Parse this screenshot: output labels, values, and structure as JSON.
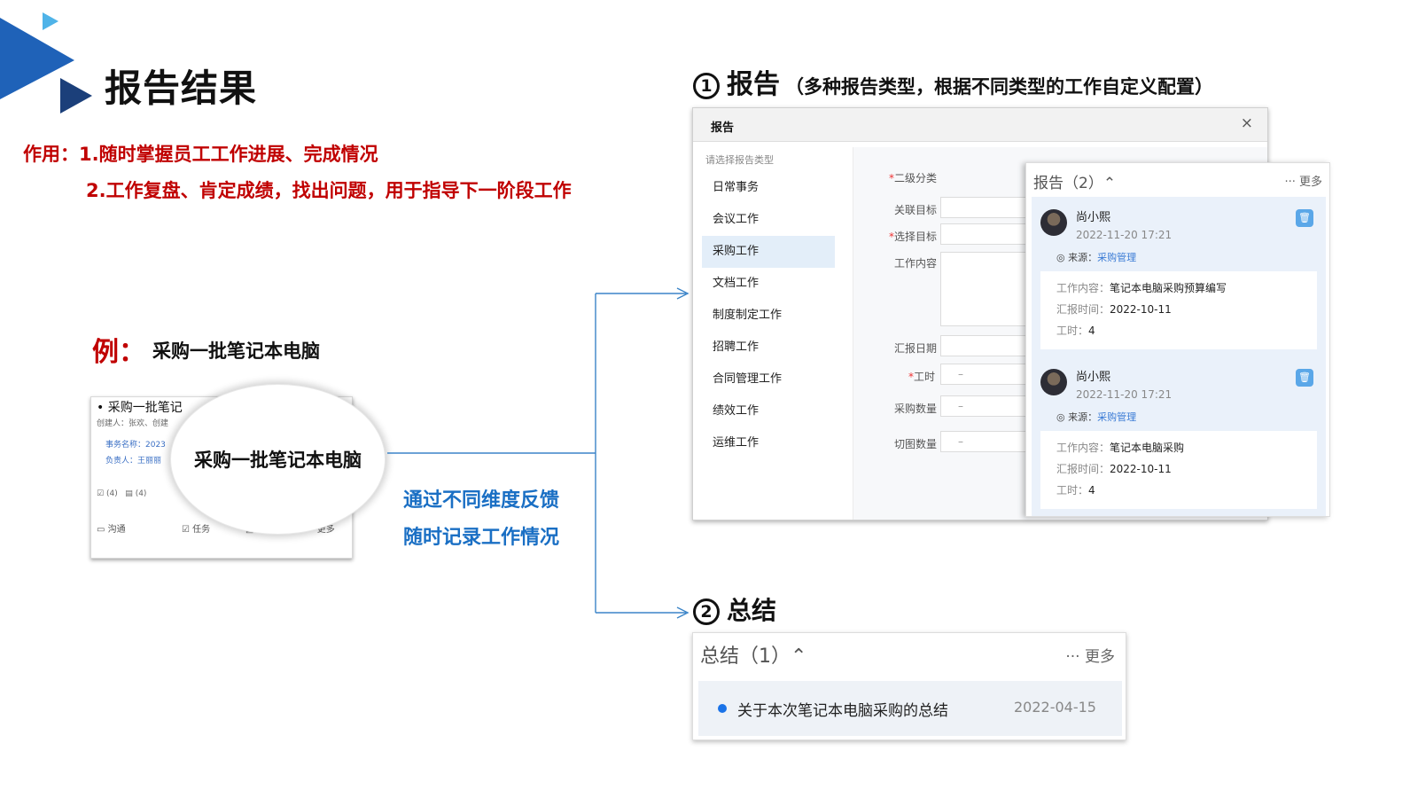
{
  "slide": {
    "title": "报告结果",
    "purpose_line1": "作用：1.随时掌握员工工作进展、完成情况",
    "purpose_line2": "2.工作复盘、肯定成绩，找出问题，用于指导下一阶段工作",
    "example_label": "例：",
    "example_text": "采购一批笔记本电脑",
    "feedback_line1": "通过不同维度反馈",
    "feedback_line2": "随时记录工作情况"
  },
  "colors": {
    "accent_blue": "#1a6fc4",
    "accent_red": "#c00000",
    "deco_blue": "#1f62b8"
  },
  "mini_card": {
    "title": "采购一批笔记",
    "creator_line": "创建人：张欢、创建",
    "field1": "事务名称：2023",
    "field2": "负责人：王丽丽",
    "count1": "(4)",
    "count2": "(4)",
    "footer": {
      "communicate": "沟通",
      "task": "任务",
      "report": "报告",
      "more": "··· 更多"
    }
  },
  "magnifier_text": "采购一批笔记本电脑",
  "section1": {
    "num": "1",
    "title": "报告",
    "subtitle": "（多种报告类型，根据不同类型的工作自定义配置）"
  },
  "section2": {
    "num": "2",
    "title": "总结"
  },
  "dialog": {
    "title": "报告",
    "close": "×",
    "hint": "请选择报告类型",
    "types": [
      "日常事务",
      "会议工作",
      "采购工作",
      "文档工作",
      "制度制定工作",
      "招聘工作",
      "合同管理工作",
      "绩效工作",
      "运维工作"
    ],
    "form": {
      "level2": "二级分类",
      "related_goal": "关联目标",
      "select_goal": "选择目标",
      "work_content": "工作内容",
      "report_date": "汇报日期",
      "hours": "工时",
      "purchase_qty": "采购数量",
      "cut_qty": "切图数量",
      "dash": "–"
    }
  },
  "report_panel": {
    "header": "报告（2）⌃",
    "more": "··· 更多",
    "cards": [
      {
        "name": "尚小熙",
        "time": "2022-11-20 17:21",
        "source_label": "来源：",
        "source_link": "采购管理",
        "content_label": "工作内容：",
        "content": "笔记本电脑采购预算编写",
        "date_label": "汇报时间：",
        "date": "2022-10-11",
        "hours_label": "工时：",
        "hours": "4"
      },
      {
        "name": "尚小熙",
        "time": "2022-11-20 17:21",
        "source_label": "来源：",
        "source_link": "采购管理",
        "content_label": "工作内容：",
        "content": "笔记本电脑采购",
        "date_label": "汇报时间：",
        "date": "2022-10-11",
        "hours_label": "工时：",
        "hours": "4"
      }
    ]
  },
  "summary_panel": {
    "header": "总结（1）⌃",
    "more": "··· 更多",
    "item_title": "关于本次笔记本电脑采购的总结",
    "item_date": "2022-04-15"
  }
}
